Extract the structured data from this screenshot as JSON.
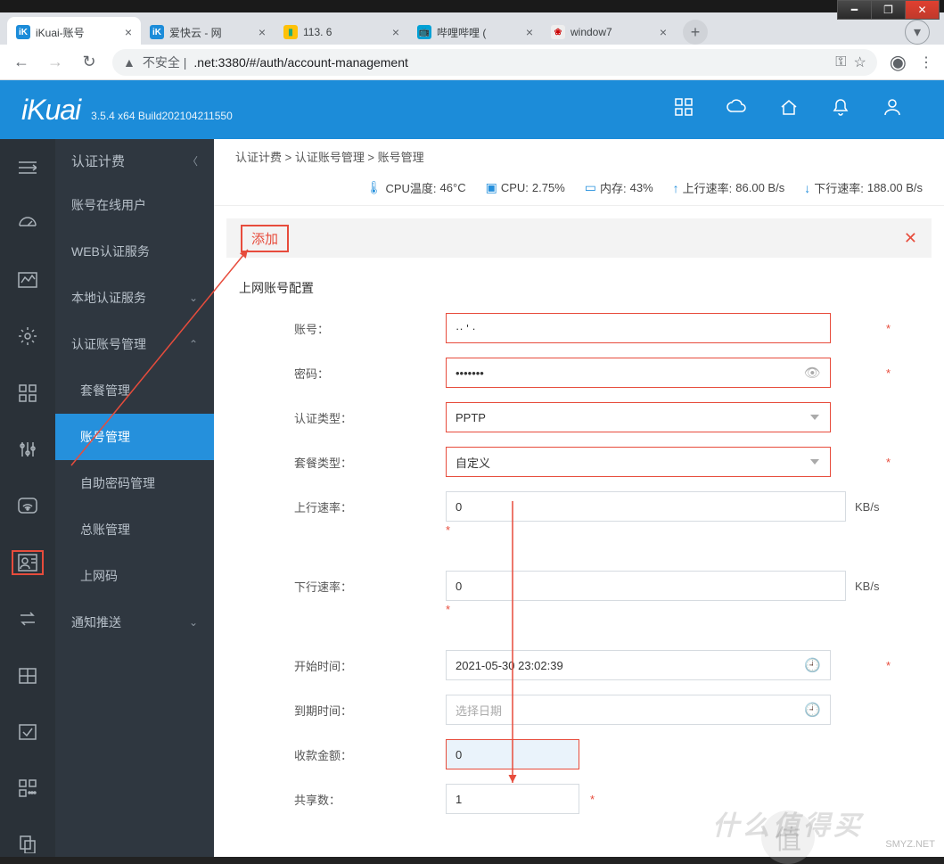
{
  "window": {
    "minimize": "━",
    "maximize": "❐",
    "close": "✕"
  },
  "browser": {
    "tabs": [
      {
        "title": "iKuai-账号",
        "favicon": "iK",
        "favBg": "#1c8cd9",
        "favColor": "#fff"
      },
      {
        "title": "爱快云 - 网",
        "favicon": "iK",
        "favBg": "#1c8cd9",
        "favColor": "#fff"
      },
      {
        "title": "113.       6",
        "favicon": "▮",
        "favBg": "#ffc107",
        "favColor": "#2a7"
      },
      {
        "title": "哔哩哔哩 (",
        "favicon": "📺",
        "favBg": "#00a1d6",
        "favColor": "#fff"
      },
      {
        "title": "window7",
        "favicon": "❀",
        "favBg": "#eee",
        "favColor": "#c00"
      }
    ],
    "new_tab": "+",
    "url_prefix": "不安全 |",
    "url": ".net:3380/#/auth/account-management",
    "nav": {
      "back": "←",
      "forward": "→",
      "reload": "↻"
    },
    "actions": {
      "key": "⚿",
      "star": "☆",
      "profile": "◉",
      "menu": "⋮"
    }
  },
  "header": {
    "logo": "iKuai",
    "build": "3.5.4 x64 Build202104211550",
    "icons": {
      "apps": "▦",
      "cloud": "☁",
      "home": "⌂",
      "bell": "♤",
      "user": "⍶"
    }
  },
  "rail": {
    "items": [
      "collapse",
      "dashboard",
      "monitor",
      "settings",
      "apps",
      "tuning",
      "wifi",
      "auth",
      "flow",
      "grid",
      "check",
      "more",
      "copy"
    ]
  },
  "sidebar": {
    "head": "认证计费",
    "items": [
      {
        "label": "账号在线用户"
      },
      {
        "label": "WEB认证服务"
      },
      {
        "label": "本地认证服务",
        "chev": "⌄"
      },
      {
        "label": "认证账号管理",
        "chev": "⌃"
      },
      {
        "label": "套餐管理",
        "sub": true
      },
      {
        "label": "账号管理",
        "sub": true,
        "active": true
      },
      {
        "label": "自助密码管理",
        "sub": true
      },
      {
        "label": "总账管理",
        "sub": true
      },
      {
        "label": "上网码",
        "sub": true
      },
      {
        "label": "通知推送",
        "chev": "⌄"
      }
    ]
  },
  "breadcrumb": "认证计费  >  认证账号管理  >  账号管理",
  "status": {
    "temp_label": "CPU温度:",
    "temp_value": "46°C",
    "cpu_label": "CPU:",
    "cpu_value": "2.75%",
    "mem_label": "内存:",
    "mem_value": "43%",
    "up_label": "上行速率:",
    "up_value": "86.00 B/s",
    "down_label": "下行速率:",
    "down_value": "188.00 B/s"
  },
  "panel": {
    "add": "添加",
    "close": "✕",
    "section": "上网账号配置",
    "form": {
      "account_label": "账号：",
      "account_value": "··  ' ·",
      "password_label": "密码：",
      "password_value": "•••••••",
      "authtype_label": "认证类型：",
      "authtype_value": "PPTP",
      "plantype_label": "套餐类型：",
      "plantype_value": "自定义",
      "uprate_label": "上行速率：",
      "uprate_value": "0",
      "uprate_suffix": "KB/s",
      "downrate_label": "下行速率：",
      "downrate_value": "0",
      "downrate_suffix": "KB/s",
      "start_label": "开始时间：",
      "start_value": "2021-05-30 23:02:39",
      "end_label": "到期时间：",
      "end_placeholder": "选择日期",
      "amount_label": "收款金额：",
      "amount_value": "0",
      "share_label": "共享数：",
      "share_value": "1",
      "req": "*"
    }
  },
  "watermark": {
    "text": "SMYZ.NET",
    "zhi": "什么值得买",
    "badge": "值"
  }
}
